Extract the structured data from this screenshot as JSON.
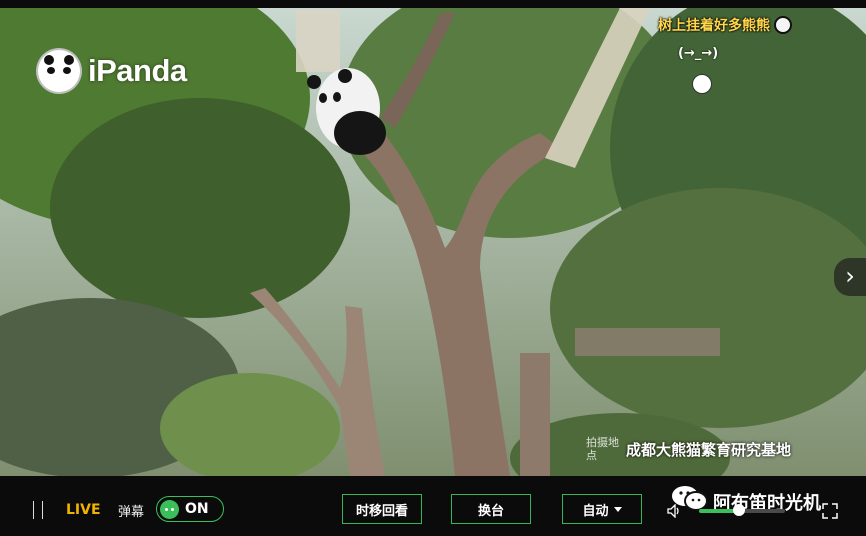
{
  "stream": {
    "brand": "iPanda",
    "headline": "树上挂着好多熊熊",
    "sub_caption": "(→_→)",
    "location_tag": "拍摄地点",
    "location_name": "成都大熊猫繁育研究基地"
  },
  "controls": {
    "live_label": "LIVE",
    "danmaku_label": "弹幕",
    "danmaku_state": "ON",
    "timeshift_label": "时移回看",
    "channel_label": "换台",
    "quality_label": "自动",
    "volume_level": 0.47
  },
  "overlay": {
    "watermark": "阿布笛时光机"
  },
  "colors": {
    "accent_green": "#3bbf5b",
    "live_yellow": "#f0b400",
    "headline_yellow": "#ffd54a"
  },
  "icons": [
    "ipanda-logo-icon",
    "panda-face-icon",
    "chevron-right-icon",
    "wechat-icon",
    "volume-icon",
    "fullscreen-icon"
  ]
}
